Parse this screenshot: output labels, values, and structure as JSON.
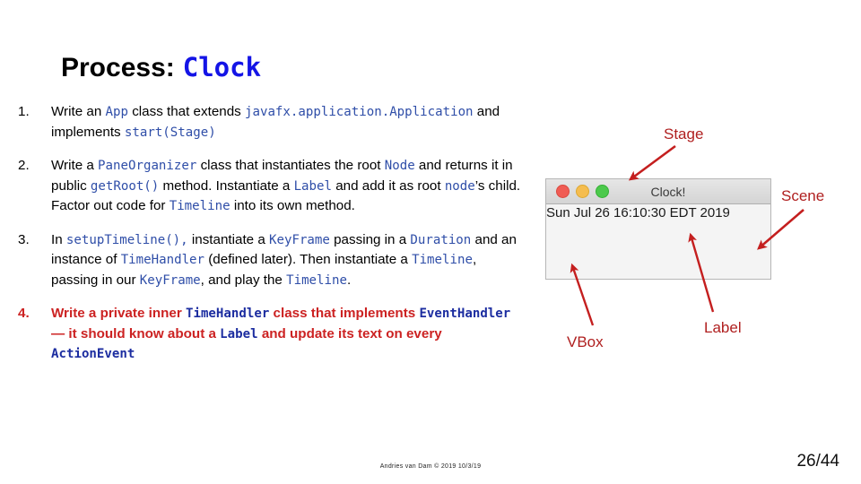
{
  "title": {
    "prefix": "Process:",
    "code": "Clock"
  },
  "steps": [
    {
      "number": "1.",
      "segments": [
        {
          "text": "Write an ",
          "style": "plain"
        },
        {
          "text": "App",
          "style": "code"
        },
        {
          "text": " class that extends ",
          "style": "plain"
        },
        {
          "text": "javafx.application.Application",
          "style": "code"
        },
        {
          "text": " and implements ",
          "style": "plain"
        },
        {
          "text": "start(Stage)",
          "style": "code"
        }
      ]
    },
    {
      "number": "2.",
      "segments": [
        {
          "text": "Write a ",
          "style": "plain"
        },
        {
          "text": "PaneOrganizer",
          "style": "code"
        },
        {
          "text": " class that instantiates the root ",
          "style": "plain"
        },
        {
          "text": "Node",
          "style": "code"
        },
        {
          "text": " and returns it in public ",
          "style": "plain"
        },
        {
          "text": "getRoot()",
          "style": "code"
        },
        {
          "text": " method. Instantiate a ",
          "style": "plain"
        },
        {
          "text": "Label",
          "style": "code"
        },
        {
          "text": " and add it as root ",
          "style": "plain"
        },
        {
          "text": "node",
          "style": "code"
        },
        {
          "text": "’s child. Factor out code for ",
          "style": "plain"
        },
        {
          "text": "Timeline",
          "style": "code"
        },
        {
          "text": " into its own method.",
          "style": "plain"
        }
      ]
    },
    {
      "number": "3.",
      "segments": [
        {
          "text": "In ",
          "style": "plain"
        },
        {
          "text": "setupTimeline(),",
          "style": "code"
        },
        {
          "text": "  instantiate a ",
          "style": "plain"
        },
        {
          "text": "KeyFrame",
          "style": "code"
        },
        {
          "text": " passing in a ",
          "style": "plain"
        },
        {
          "text": "Duration",
          "style": "code"
        },
        {
          "text": " and an instance of ",
          "style": "plain"
        },
        {
          "text": "TimeHandler",
          "style": "code"
        },
        {
          "text": " (defined later). Then instantiate a ",
          "style": "plain"
        },
        {
          "text": "Timeline",
          "style": "code"
        },
        {
          "text": ", passing in our ",
          "style": "plain"
        },
        {
          "text": "KeyFrame",
          "style": "code"
        },
        {
          "text": ", and play the ",
          "style": "plain"
        },
        {
          "text": "Timeline",
          "style": "code"
        },
        {
          "text": ".",
          "style": "plain"
        }
      ]
    },
    {
      "number": "4.",
      "highlight": true,
      "segments": [
        {
          "text": "Write a private inner ",
          "style": "plain"
        },
        {
          "text": "TimeHandler",
          "style": "code"
        },
        {
          "text": " class that implements ",
          "style": "plain"
        },
        {
          "text": "EventHandler",
          "style": "code"
        },
        {
          "text": " — it should know about a ",
          "style": "plain"
        },
        {
          "text": "Label",
          "style": "code"
        },
        {
          "text": " and update its text on every ",
          "style": "plain"
        },
        {
          "text": "ActionEvent",
          "style": "code"
        }
      ]
    }
  ],
  "clock_window": {
    "title": "Clock!",
    "time_text": "Sun Jul 26 16:10:30 EDT 2019",
    "traffic_lights": [
      "close-red",
      "minimize-yellow",
      "zoom-green"
    ]
  },
  "annotations": [
    {
      "id": "stage",
      "label": "Stage"
    },
    {
      "id": "scene",
      "label": "Scene"
    },
    {
      "id": "vbox",
      "label": "VBox"
    },
    {
      "id": "label",
      "label": "Label"
    }
  ],
  "footer": {
    "credit": "Andries van Dam © 2019 10/3/19",
    "page": "26/44"
  },
  "colors": {
    "code_blue": "#2F4EA8",
    "title_blue": "#1414E6",
    "highlight_red": "#CC2222",
    "annotation_red": "#B02020"
  }
}
